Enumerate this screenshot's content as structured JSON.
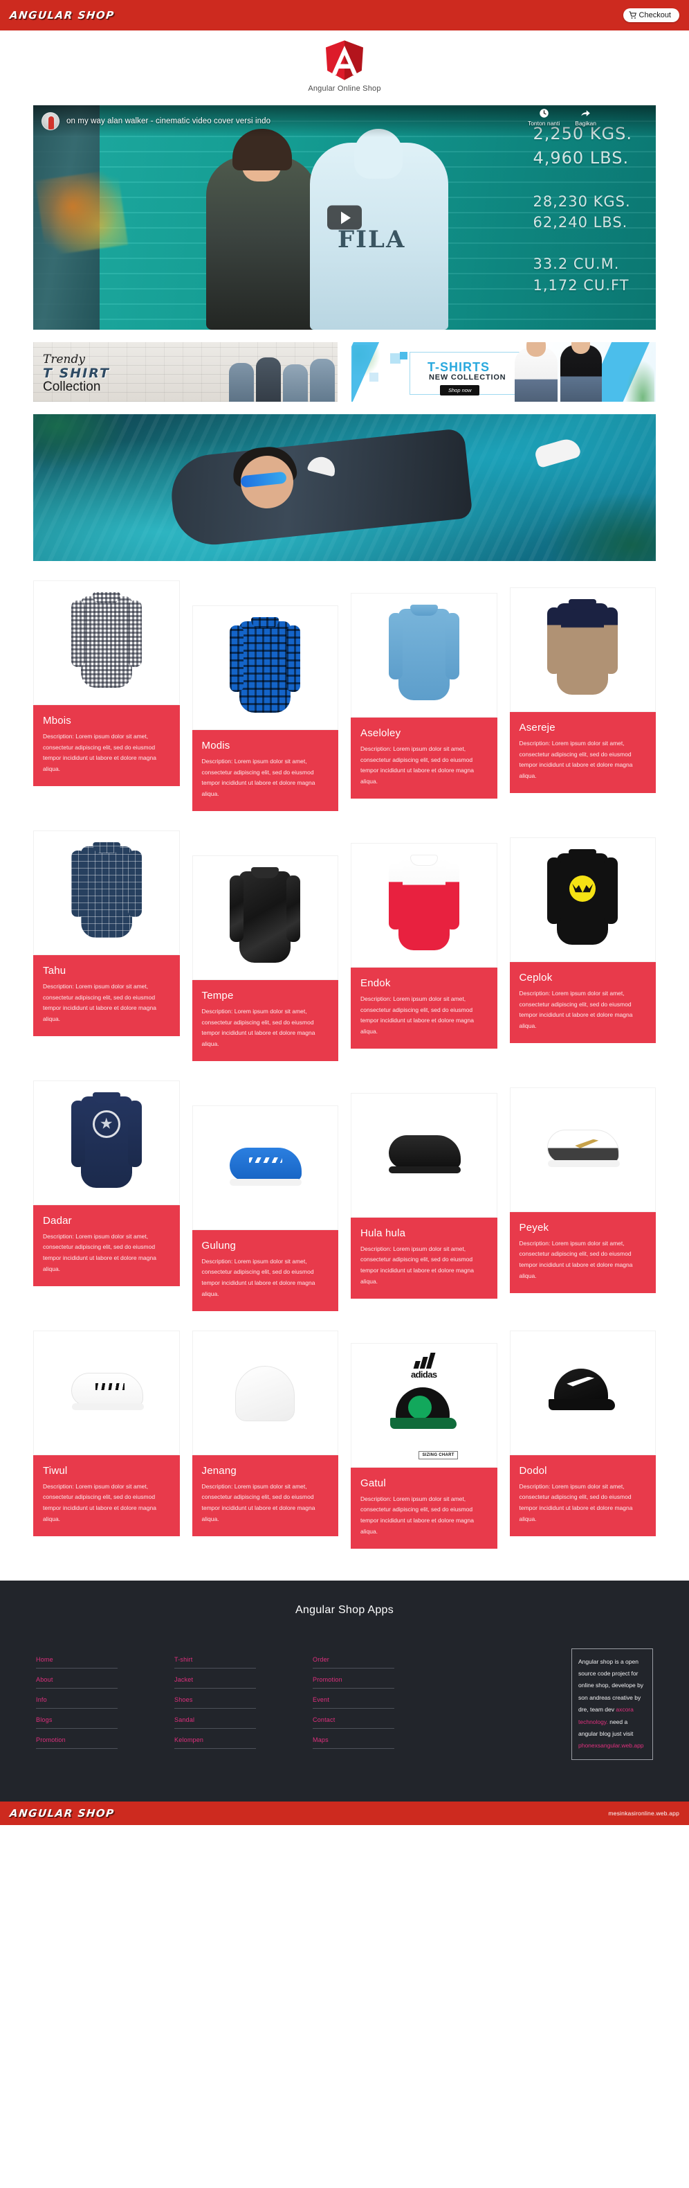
{
  "header": {
    "brand": "ANGULAR SHOP",
    "checkout_label": "Checkout",
    "cart_icon": "shopping-cart-icon"
  },
  "logo": {
    "icon": "angular-shield-icon",
    "site_title": "Angular Online Shop"
  },
  "video": {
    "title": "on my way alan walker - cinematic video cover versi indo",
    "watch_later_label": "Tonton nanti",
    "share_label": "Bagikan",
    "watch_later_icon": "clock-icon",
    "share_icon": "share-arrow-icon",
    "play_icon": "play-button-icon",
    "specs": {
      "line1": "2,250  KGS.",
      "line2": "4,960  LBS.",
      "line3": "28,230  KGS.",
      "line4": "62,240  LBS.",
      "line5": "33.2  CU.M.",
      "line6": "1,172  CU.FT"
    }
  },
  "promos": [
    {
      "name": "trendy-tshirt-collection",
      "line1": "Trendy",
      "line2": "T SHIRT",
      "line3": "Collection"
    },
    {
      "name": "tshirts-new-collection",
      "line1": "T-SHIRTS",
      "line2": "NEW COLLECTION",
      "button": "Shop now"
    }
  ],
  "hero": {
    "name": "featured-hero-banner"
  },
  "products_description": "Description: Lorem ipsum dolor sit amet, consectetur adipiscing elit, sed do eiusmod tempor incididunt ut labore et dolore magna aliqua.",
  "product_rows": [
    [
      {
        "title": "Mbois",
        "art": "shirt-gingham"
      },
      {
        "title": "Modis",
        "art": "shirt-plaid-blue"
      },
      {
        "title": "Aseloley",
        "art": "shirt-denim"
      },
      {
        "title": "Asereje",
        "art": "shirt-two-tone"
      }
    ],
    [
      {
        "title": "Tahu",
        "art": "shirt-plaid-navy"
      },
      {
        "title": "Tempe",
        "art": "jacket-leather"
      },
      {
        "title": "Endok",
        "art": "jacket-windbreaker"
      },
      {
        "title": "Ceplok",
        "art": "tee-batman"
      }
    ],
    [
      {
        "title": "Dadar",
        "art": "tee-captain"
      },
      {
        "title": "Gulung",
        "art": "shoe-adidas-blue"
      },
      {
        "title": "Hula hula",
        "art": "shoe-black"
      },
      {
        "title": "Peyek",
        "art": "shoe-nike-white"
      }
    ],
    [
      {
        "title": "Tiwul",
        "art": "shoe-superstar"
      },
      {
        "title": "Jenang",
        "art": "beanie-white"
      },
      {
        "title": "Gatul",
        "art": "cap-adidas-celtics"
      },
      {
        "title": "Dodol",
        "art": "cap-nike-black"
      }
    ]
  ],
  "footer": {
    "title": "Angular Shop Apps",
    "columns": [
      {
        "links": [
          "Home",
          "About",
          "Info",
          "Blogs",
          "Promotion"
        ]
      },
      {
        "links": [
          "T-shirt",
          "Jacket",
          "Shoes",
          "Sandal",
          "Kelompen"
        ]
      },
      {
        "links": [
          "Order",
          "Promotion",
          "Event",
          "Contact",
          "Maps"
        ]
      }
    ],
    "info_box": {
      "text1": "Angular shop is a open source code project for online shop, develope by son andreas creative by dre, team dev ",
      "link1": "axcora technology.",
      "text2": " need a angular blog just visit ",
      "link2": "phonexsangular.web.app"
    }
  },
  "bottom": {
    "brand": "ANGULAR SHOP",
    "url": "mesinkasironline.web.app"
  },
  "colors": {
    "brand_red": "#cd2a1f",
    "card_red": "#e83a4b",
    "footer_bg": "#22252b",
    "link_pink": "#e0307e"
  }
}
